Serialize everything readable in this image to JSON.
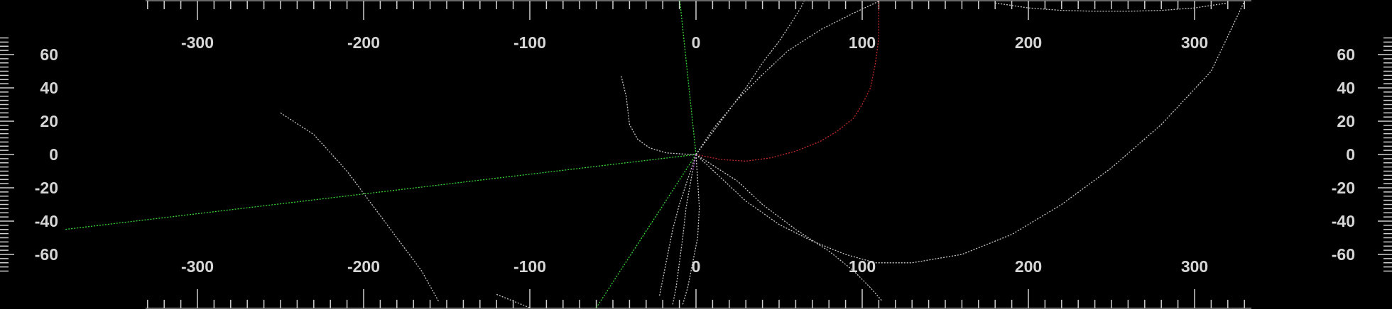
{
  "chart_data": {
    "type": "line",
    "title": "",
    "xlabel": "",
    "ylabel": "",
    "xlim": [
      -410,
      420
    ],
    "ylim": [
      -86,
      92
    ],
    "grid": false,
    "legend": "none",
    "x_tick_labels": [
      "-300",
      "-200",
      "-100",
      "0",
      "100",
      "200",
      "300"
    ],
    "x_tick_values": [
      -300,
      -200,
      -100,
      0,
      100,
      200,
      300
    ],
    "y_tick_labels": [
      "60",
      "40",
      "20",
      "0",
      "-20",
      "-40",
      "-60"
    ],
    "y_tick_values": [
      60,
      40,
      20,
      0,
      -20,
      -40,
      -60
    ],
    "colors": {
      "background": "#000000",
      "axis": "#cfcfcf",
      "label": "#d6d6d6",
      "green": "#37d637",
      "red": "#c22a2a",
      "white": "#c8c8c8",
      "purple": "#a040c0"
    },
    "series": [
      {
        "color": "#37d637",
        "x": [
          0,
          -380
        ],
        "y": [
          0,
          -45
        ]
      },
      {
        "color": "#37d637",
        "x": [
          0,
          -10
        ],
        "y": [
          0,
          95
        ]
      },
      {
        "color": "#37d637",
        "x": [
          0,
          -60
        ],
        "y": [
          0,
          -92
        ]
      },
      {
        "color": "#c22a2a",
        "x": [
          0,
          15,
          30,
          45,
          60,
          75,
          85,
          95,
          100,
          105,
          108,
          110,
          110
        ],
        "y": [
          0,
          -3,
          -4,
          -2,
          2,
          8,
          14,
          22,
          30,
          40,
          55,
          70,
          92
        ]
      },
      {
        "color": "#c8c8c8",
        "x": [
          -45,
          -42,
          -40,
          -35,
          -28,
          -18,
          -8,
          0
        ],
        "y": [
          47,
          35,
          18,
          9,
          4,
          1,
          0.3,
          0
        ]
      },
      {
        "color": "#c8c8c8",
        "x": [
          0,
          15,
          30,
          50,
          70,
          90,
          108,
          130,
          160,
          190,
          220,
          250,
          280,
          310,
          330
        ],
        "y": [
          0,
          -14,
          -28,
          -42,
          -52,
          -60,
          -65,
          -65,
          -60,
          -48,
          -30,
          -8,
          18,
          50,
          92
        ]
      },
      {
        "color": "#c8c8c8",
        "x": [
          -250,
          -230,
          -210,
          -195,
          -180,
          -165,
          -155
        ],
        "y": [
          25,
          12,
          -10,
          -30,
          -50,
          -70,
          -88
        ]
      },
      {
        "color": "#c8c8c8",
        "x": [
          0,
          25,
          40,
          60,
          80,
          95,
          105,
          112
        ],
        "y": [
          0,
          -16,
          -30,
          -45,
          -58,
          -70,
          -80,
          -88
        ]
      },
      {
        "color": "#c8c8c8",
        "x": [
          0,
          10,
          25,
          40,
          55,
          75,
          95,
          110
        ],
        "y": [
          0,
          15,
          33,
          48,
          62,
          75,
          85,
          92
        ]
      },
      {
        "color": "#c8c8c8",
        "x": [
          0,
          15,
          30,
          40,
          50,
          58,
          63,
          65
        ],
        "y": [
          0,
          20,
          40,
          55,
          68,
          80,
          88,
          92
        ]
      },
      {
        "color": "#c8c8c8",
        "x": [
          -120,
          -115,
          -110,
          -105,
          -100
        ],
        "y": [
          -84,
          -86,
          -88,
          -90,
          -92
        ]
      },
      {
        "color": "#c8c8c8",
        "x": [
          0,
          -3,
          -6,
          -8,
          -10,
          -12,
          -14
        ],
        "y": [
          0,
          -15,
          -32,
          -50,
          -65,
          -80,
          -90
        ]
      },
      {
        "color": "#c8c8c8",
        "x": [
          0,
          1,
          2,
          1,
          -2,
          -5,
          -8
        ],
        "y": [
          0,
          -15,
          -32,
          -50,
          -65,
          -80,
          -90
        ]
      },
      {
        "color": "#c8c8c8",
        "x": [
          0,
          -5,
          -10,
          -14,
          -17,
          -20,
          -22
        ],
        "y": [
          0,
          -15,
          -30,
          -45,
          -60,
          -75,
          -85
        ]
      },
      {
        "color": "#c8c8c8",
        "x": [
          180,
          200,
          220,
          240,
          260,
          280,
          300,
          320
        ],
        "y": [
          91,
          88,
          86.5,
          86,
          86,
          86.5,
          88,
          91
        ]
      },
      {
        "color": "#a040c0",
        "x": [
          0,
          -1,
          -2
        ],
        "y": [
          0,
          -5,
          -10
        ]
      }
    ]
  }
}
